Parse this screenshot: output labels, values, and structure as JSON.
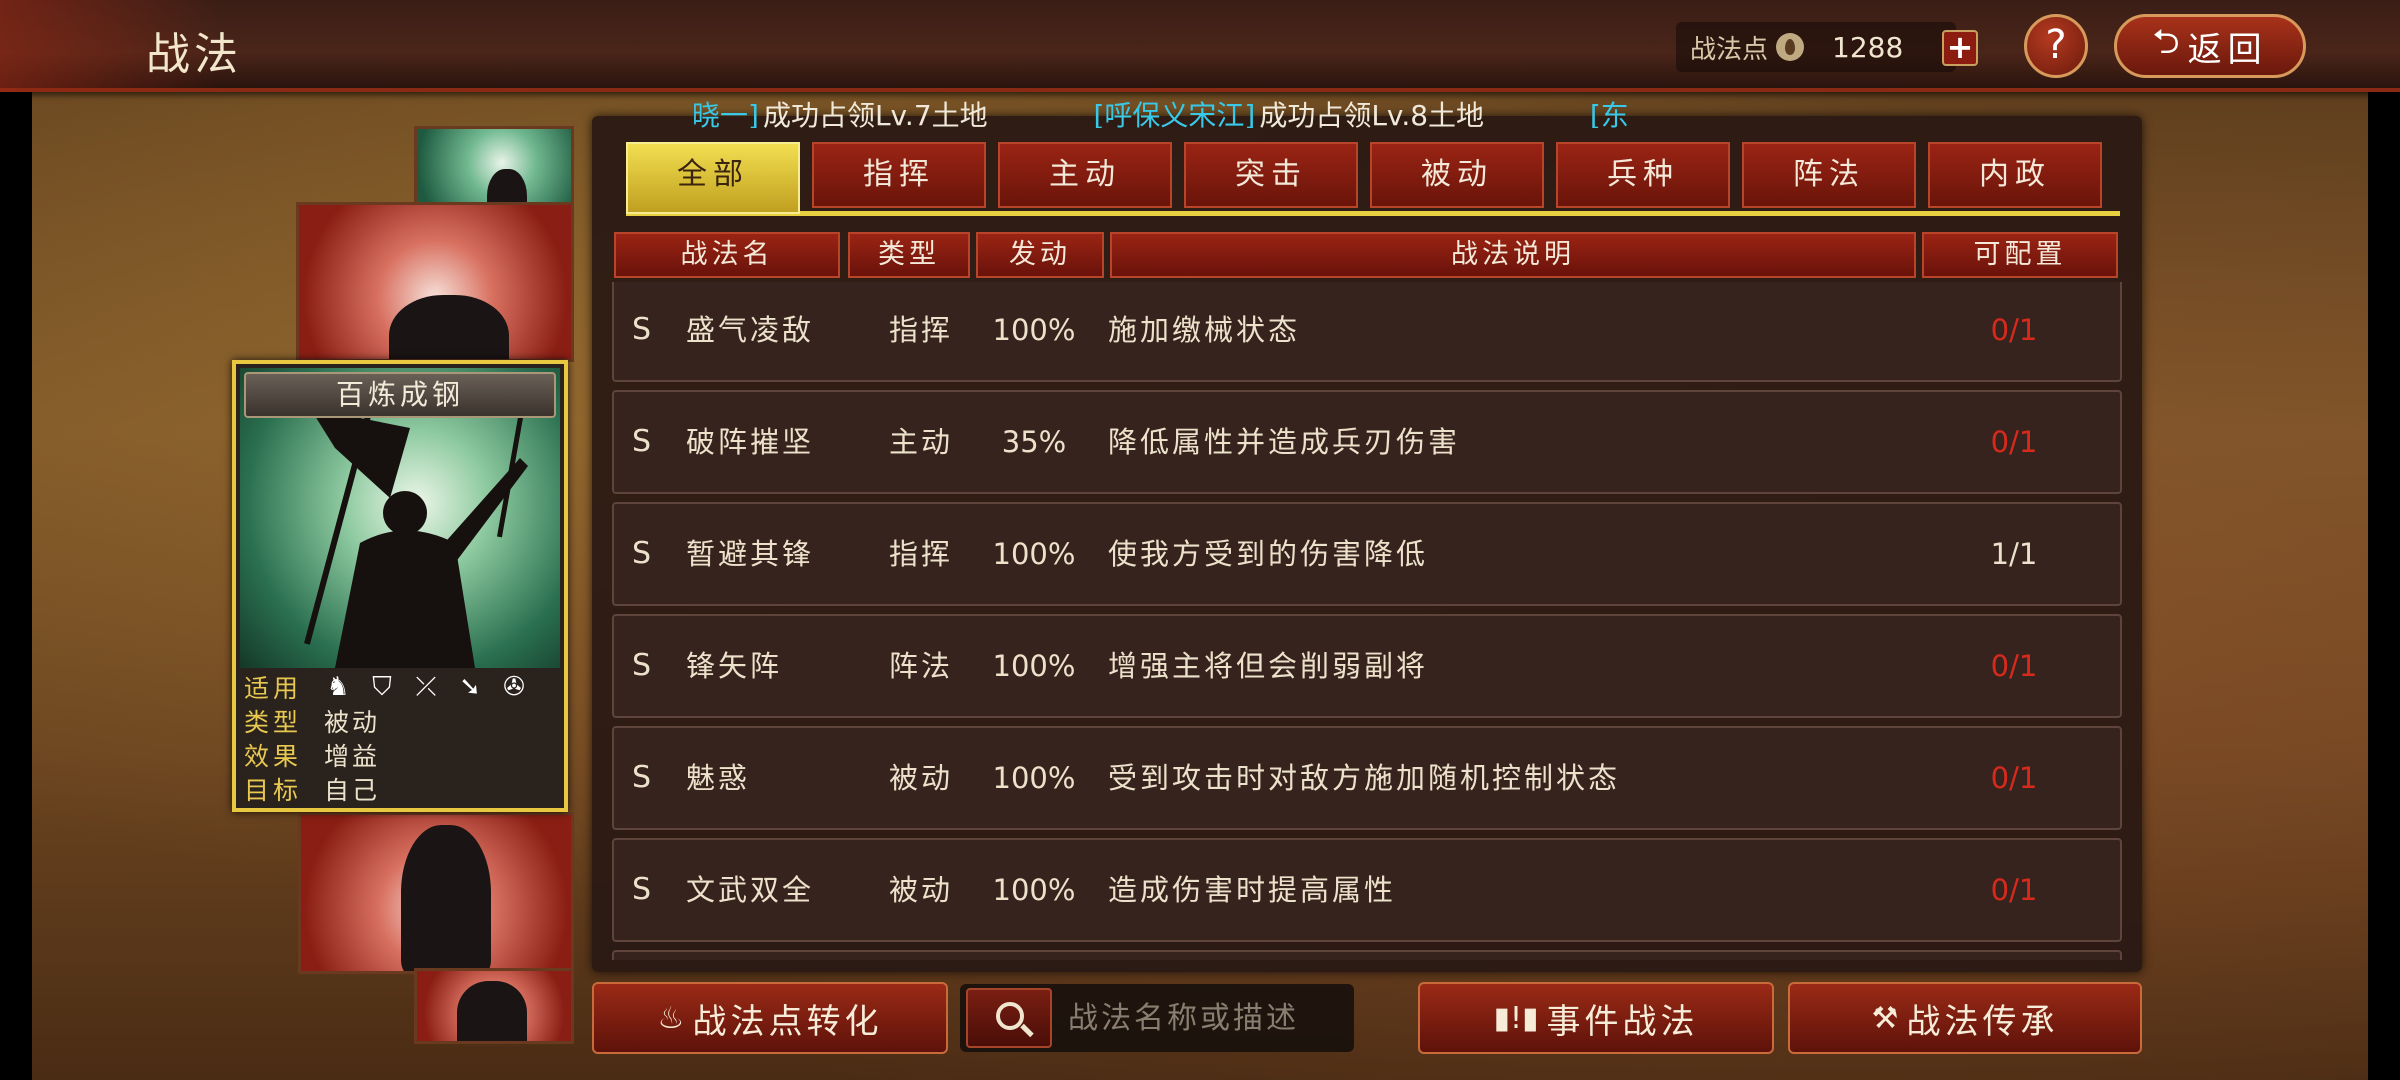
{
  "header": {
    "title": "战法",
    "points_label": "战法点",
    "points_value": "1288",
    "plus_label": "+",
    "help_label": "?",
    "back_label": "返回"
  },
  "ticker": {
    "items": [
      {
        "name": "晓一]",
        "text": "成功占领Lv.7土地"
      },
      {
        "name": "[呼保义宋江]",
        "text": "成功占领Lv.8土地"
      },
      {
        "name": "[东",
        "text": ""
      }
    ]
  },
  "tabs": [
    {
      "label": "全部",
      "active": true
    },
    {
      "label": "指挥",
      "active": false
    },
    {
      "label": "主动",
      "active": false
    },
    {
      "label": "突击",
      "active": false
    },
    {
      "label": "被动",
      "active": false
    },
    {
      "label": "兵种",
      "active": false
    },
    {
      "label": "阵法",
      "active": false
    },
    {
      "label": "内政",
      "active": false
    }
  ],
  "columns": {
    "name": "战法名",
    "type": "类型",
    "trigger": "发动",
    "desc": "战法说明",
    "config": "可配置"
  },
  "rows": [
    {
      "grade": "S",
      "name": "盛气凌敌",
      "type": "指挥",
      "trigger": "100%",
      "desc": "施加缴械状态",
      "config": "0/1",
      "config_red": true
    },
    {
      "grade": "S",
      "name": "破阵摧坚",
      "type": "主动",
      "trigger": "35%",
      "desc": "降低属性并造成兵刃伤害",
      "config": "0/1",
      "config_red": true
    },
    {
      "grade": "S",
      "name": "暂避其锋",
      "type": "指挥",
      "trigger": "100%",
      "desc": "使我方受到的伤害降低",
      "config": "1/1",
      "config_red": false
    },
    {
      "grade": "S",
      "name": "锋矢阵",
      "type": "阵法",
      "trigger": "100%",
      "desc": "增强主将但会削弱副将",
      "config": "0/1",
      "config_red": true
    },
    {
      "grade": "S",
      "name": "魅惑",
      "type": "被动",
      "trigger": "100%",
      "desc": "受到攻击时对敌方施加随机控制状态",
      "config": "0/1",
      "config_red": true
    },
    {
      "grade": "S",
      "name": "文武双全",
      "type": "被动",
      "trigger": "100%",
      "desc": "造成伤害时提高属性",
      "config": "0/1",
      "config_red": true
    }
  ],
  "skill_card": {
    "name": "百炼成钢",
    "applies_label": "适用",
    "troop_icons": [
      "cavalry-icon",
      "shield-icon",
      "archer-icon",
      "spear-icon",
      "siege-icon"
    ],
    "type_label": "类型",
    "type_value": "被动",
    "effect_label": "效果",
    "effect_value": "增益",
    "target_label": "目标",
    "target_value": "自己"
  },
  "bottom": {
    "convert_label": "战法点转化",
    "search_placeholder": "战法名称或描述",
    "event_label": "事件战法",
    "inherit_label": "战法传承"
  },
  "colors": {
    "accent_gold": "#e8d040",
    "tab_red": "#9a2414",
    "config_red": "#d82a1c",
    "ticker_name": "#38c8e8"
  }
}
